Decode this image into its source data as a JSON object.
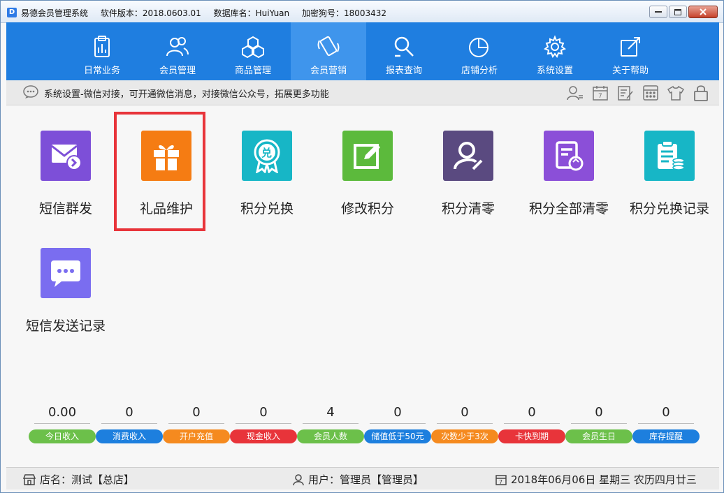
{
  "window": {
    "app_name": "易德会员管理系统",
    "version": "软件版本：2018.0603.01",
    "database": "数据库名：HuiYuan",
    "dongle": "加密狗号：18003432"
  },
  "nav": {
    "items": [
      {
        "label": "日常业务",
        "icon": "clipboard-icon"
      },
      {
        "label": "会员管理",
        "icon": "members-icon"
      },
      {
        "label": "商品管理",
        "icon": "cubes-icon"
      },
      {
        "label": "会员营销",
        "icon": "phone-icon",
        "active": true
      },
      {
        "label": "报表查询",
        "icon": "search-report-icon"
      },
      {
        "label": "店铺分析",
        "icon": "pie-chart-icon"
      },
      {
        "label": "系统设置",
        "icon": "gear-icon"
      },
      {
        "label": "关于帮助",
        "icon": "help-icon"
      }
    ]
  },
  "infobar": {
    "text": "系统设置-微信对接，可开通微信消息，对接微信公众号，拓展更多功能"
  },
  "tiles": [
    {
      "label": "短信群发",
      "icon": "sms-send-icon",
      "color": "#7d4fd8"
    },
    {
      "label": "礼品维护",
      "icon": "gift-icon",
      "color": "#f57c13"
    },
    {
      "label": "积分兑换",
      "icon": "exchange-badge-icon",
      "color": "#17b6c6"
    },
    {
      "label": "修改积分",
      "icon": "edit-icon",
      "color": "#5cba3c"
    },
    {
      "label": "积分清零",
      "icon": "user-clear-icon",
      "color": "#5a4a80"
    },
    {
      "label": "积分全部清零",
      "icon": "refresh-doc-icon",
      "color": "#8b4fd8"
    },
    {
      "label": "积分兑换记录",
      "icon": "record-icon",
      "color": "#17b6c6"
    },
    {
      "label": "短信发送记录",
      "icon": "chat-icon",
      "color": "#7a6df0"
    }
  ],
  "stats": [
    {
      "value": "0.00",
      "label": "今日收入",
      "color": "#6cc04a"
    },
    {
      "value": "0",
      "label": "消费收入",
      "color": "#1d7fde"
    },
    {
      "value": "0",
      "label": "开户充值",
      "color": "#f58a1f"
    },
    {
      "value": "0",
      "label": "现金收入",
      "color": "#e8343a"
    },
    {
      "value": "4",
      "label": "会员人数",
      "color": "#6cc04a"
    },
    {
      "value": "0",
      "label": "储值低于50元",
      "color": "#1d7fde"
    },
    {
      "value": "0",
      "label": "次数少于3次",
      "color": "#f58a1f"
    },
    {
      "value": "0",
      "label": "卡快到期",
      "color": "#e8343a"
    },
    {
      "value": "0",
      "label": "会员生日",
      "color": "#6cc04a"
    },
    {
      "value": "0",
      "label": "库存提醒",
      "color": "#1d7fde"
    }
  ],
  "statusbar": {
    "store": "店名：测试【总店】",
    "user": "用户：管理员【管理员】",
    "date": "2018年06月06日 星期三 农历四月廿三"
  }
}
